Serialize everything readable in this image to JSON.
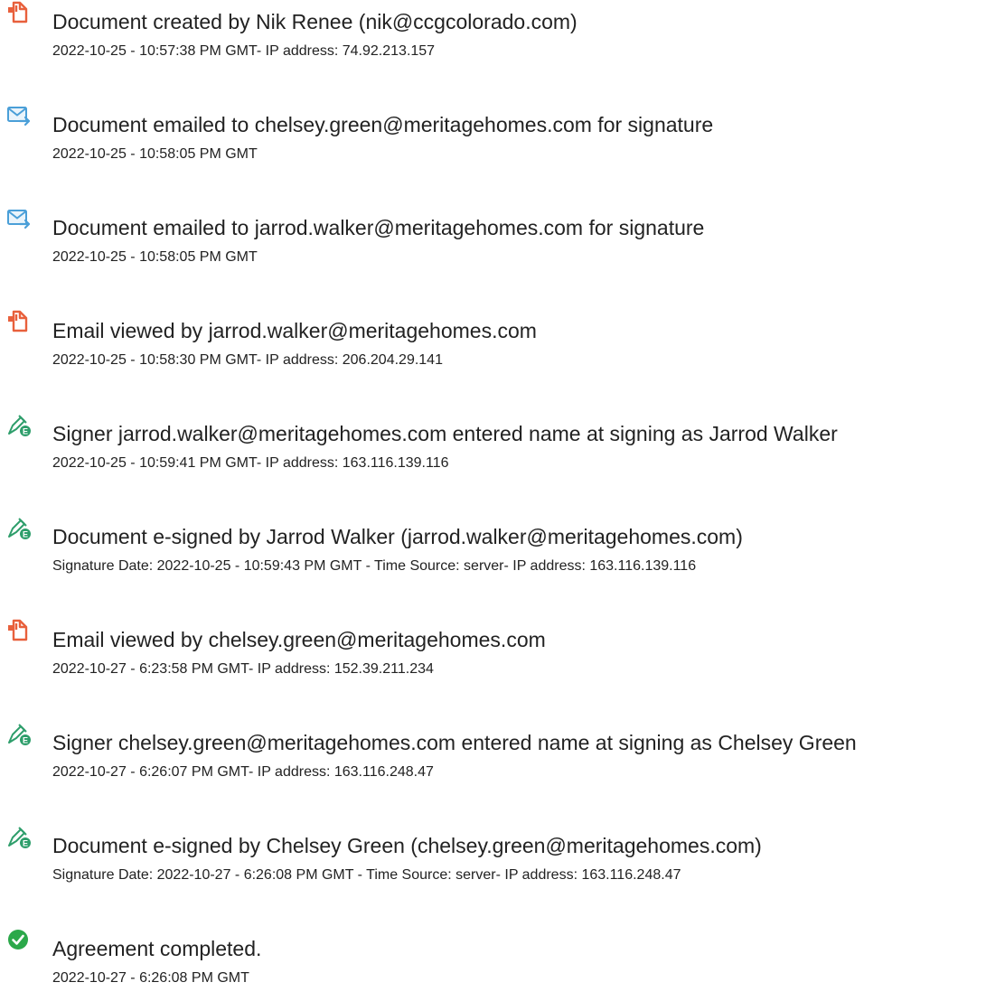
{
  "events": [
    {
      "icon": "document-created-icon",
      "title": "Document created by Nik Renee (nik@ccgcolorado.com)",
      "detail": "2022-10-25 - 10:57:38 PM GMT- IP address: 74.92.213.157"
    },
    {
      "icon": "email-sent-icon",
      "title": "Document emailed to chelsey.green@meritagehomes.com for signature",
      "detail": "2022-10-25 - 10:58:05 PM GMT"
    },
    {
      "icon": "email-sent-icon",
      "title": "Document emailed to jarrod.walker@meritagehomes.com for signature",
      "detail": "2022-10-25 - 10:58:05 PM GMT"
    },
    {
      "icon": "document-viewed-icon",
      "title": "Email viewed by jarrod.walker@meritagehomes.com",
      "detail": "2022-10-25 - 10:58:30 PM GMT- IP address: 206.204.29.141"
    },
    {
      "icon": "e-sign-pen-icon",
      "title": "Signer jarrod.walker@meritagehomes.com entered name at signing as Jarrod Walker",
      "detail": "2022-10-25 - 10:59:41 PM GMT- IP address: 163.116.139.116"
    },
    {
      "icon": "e-sign-pen-icon",
      "title": "Document e-signed by Jarrod Walker (jarrod.walker@meritagehomes.com)",
      "detail": "Signature Date: 2022-10-25 - 10:59:43 PM GMT - Time Source: server- IP address: 163.116.139.116"
    },
    {
      "icon": "document-viewed-icon",
      "title": "Email viewed by chelsey.green@meritagehomes.com",
      "detail": "2022-10-27 - 6:23:58 PM GMT- IP address: 152.39.211.234"
    },
    {
      "icon": "e-sign-pen-icon",
      "title": "Signer chelsey.green@meritagehomes.com entered name at signing as Chelsey Green",
      "detail": "2022-10-27 - 6:26:07 PM GMT- IP address: 163.116.248.47"
    },
    {
      "icon": "e-sign-pen-icon",
      "title": "Document e-signed by Chelsey Green (chelsey.green@meritagehomes.com)",
      "detail": "Signature Date: 2022-10-27 - 6:26:08 PM GMT - Time Source: server- IP address: 163.116.248.47"
    },
    {
      "icon": "completed-check-icon",
      "title": "Agreement completed.",
      "detail": "2022-10-27 - 6:26:08 PM GMT"
    }
  ],
  "colors": {
    "document_orange": "#E8603C",
    "email_blue": "#4A9FD8",
    "pen_green": "#2E9E6B",
    "check_green": "#2BA84A",
    "text": "#222222"
  }
}
